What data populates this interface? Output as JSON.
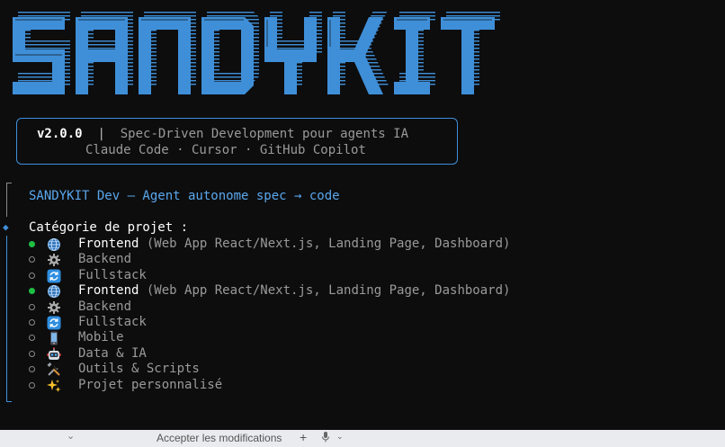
{
  "banner": {
    "text": "SANDYKIT",
    "color": "#3f8fd8"
  },
  "info": {
    "version": "v2.0.0",
    "separator": "|",
    "tagline": "Spec-Driven Development pour agents IA",
    "tools": "Claude Code · Cursor · GitHub Copilot"
  },
  "agent": {
    "title": "SANDYKIT Dev — Agent autonome spec → code"
  },
  "prompt": {
    "question": "Catégorie de projet :",
    "options": [
      {
        "icon": "globe-icon",
        "label": "Frontend",
        "hint": " (Web App React/Next.js, Landing Page, Dashboard)",
        "selected": true
      },
      {
        "icon": "gear-icon",
        "label": "Backend",
        "hint": "",
        "selected": false
      },
      {
        "icon": "refresh-icon",
        "label": "Fullstack",
        "hint": "",
        "selected": false
      },
      {
        "icon": "globe-icon",
        "label": "Frontend",
        "hint": " (Web App React/Next.js, Landing Page, Dashboard)",
        "selected": true
      },
      {
        "icon": "gear-icon",
        "label": "Backend",
        "hint": "",
        "selected": false
      },
      {
        "icon": "refresh-icon",
        "label": "Fullstack",
        "hint": "",
        "selected": false
      },
      {
        "icon": "mobile-phone-icon",
        "label": "Mobile",
        "hint": "",
        "selected": false
      },
      {
        "icon": "robot-icon",
        "label": "Data & IA",
        "hint": "",
        "selected": false
      },
      {
        "icon": "tools-icon",
        "label": "Outils & Scripts",
        "hint": "",
        "selected": false
      },
      {
        "icon": "sparkles-icon",
        "label": "Projet personnalisé",
        "hint": "",
        "selected": false
      }
    ]
  },
  "bottom_bar": {
    "accept_label": "Accepter les modifications",
    "add_label": "+"
  },
  "colors": {
    "accent": "#3f8fd8",
    "selected_radio": "#1fbf43",
    "muted": "#9a9a9a"
  }
}
